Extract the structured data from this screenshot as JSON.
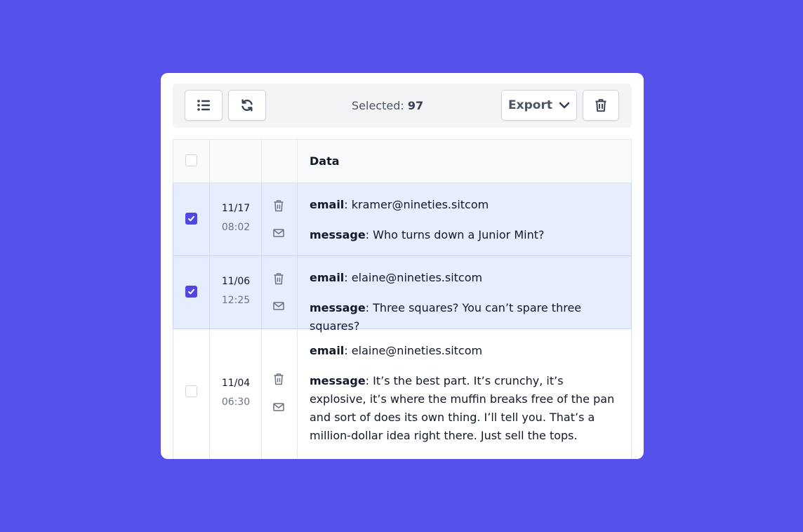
{
  "toolbar": {
    "list_icon": "list-icon",
    "refresh_icon": "refresh-icon",
    "selected_label": "Selected:",
    "selected_count": "97",
    "export_label": "Export",
    "export_icon": "chevron-down-icon",
    "delete_icon": "trash-icon"
  },
  "table": {
    "header": {
      "data_label": "Data"
    },
    "rows": [
      {
        "checked": true,
        "date": "11/17",
        "time": "08:02",
        "email_key": "email",
        "email": "kramer@nineties.sitcom",
        "message_key": "message",
        "message": "Who turns down a Junior Mint?"
      },
      {
        "checked": true,
        "date": "11/06",
        "time": "12:25",
        "email_key": "email",
        "email": "elaine@nineties.sitcom",
        "message_key": "message",
        "message": "Three squares? You can’t spare three squares?"
      },
      {
        "checked": false,
        "date": "11/04",
        "time": "06:30",
        "email_key": "email",
        "email": "elaine@nineties.sitcom",
        "message_key": "message",
        "message": "It’s the best part. It’s crunchy, it’s explosive, it’s where the muffin breaks free of the pan and sort of does its own thing. I’ll tell you. That’s a million-dollar idea right there. Just sell the tops."
      }
    ]
  },
  "colors": {
    "background": "#5751ec",
    "accent": "#4f46e5",
    "selected_row": "#e6edfd"
  }
}
